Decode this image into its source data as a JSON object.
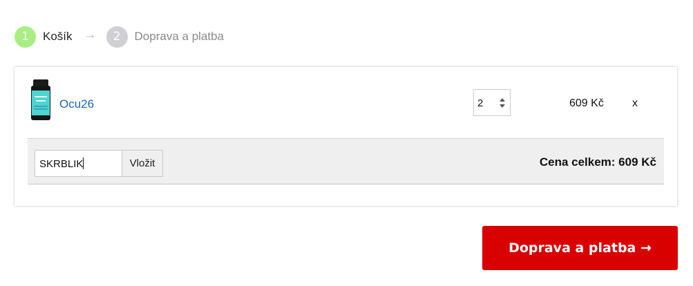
{
  "steps": [
    {
      "number": "1",
      "label": "Košík",
      "state": "active"
    },
    {
      "number": "2",
      "label": "Doprava a platba",
      "state": "inactive"
    }
  ],
  "step_arrow": "→",
  "cart": {
    "items": [
      {
        "name": "Ocu26",
        "quantity": "2",
        "price": "609 Kč",
        "remove_label": "x"
      }
    ],
    "coupon": {
      "value": "SKRBLIK",
      "apply_label": "Vložit"
    },
    "total_label": "Cena celkem: 609 Kč"
  },
  "checkout_button": {
    "label": "Doprava a platba →"
  },
  "colors": {
    "step_active": "#a8ee83",
    "step_inactive": "#cfcfd4",
    "link": "#1a66b8",
    "checkout": "#d90000"
  }
}
